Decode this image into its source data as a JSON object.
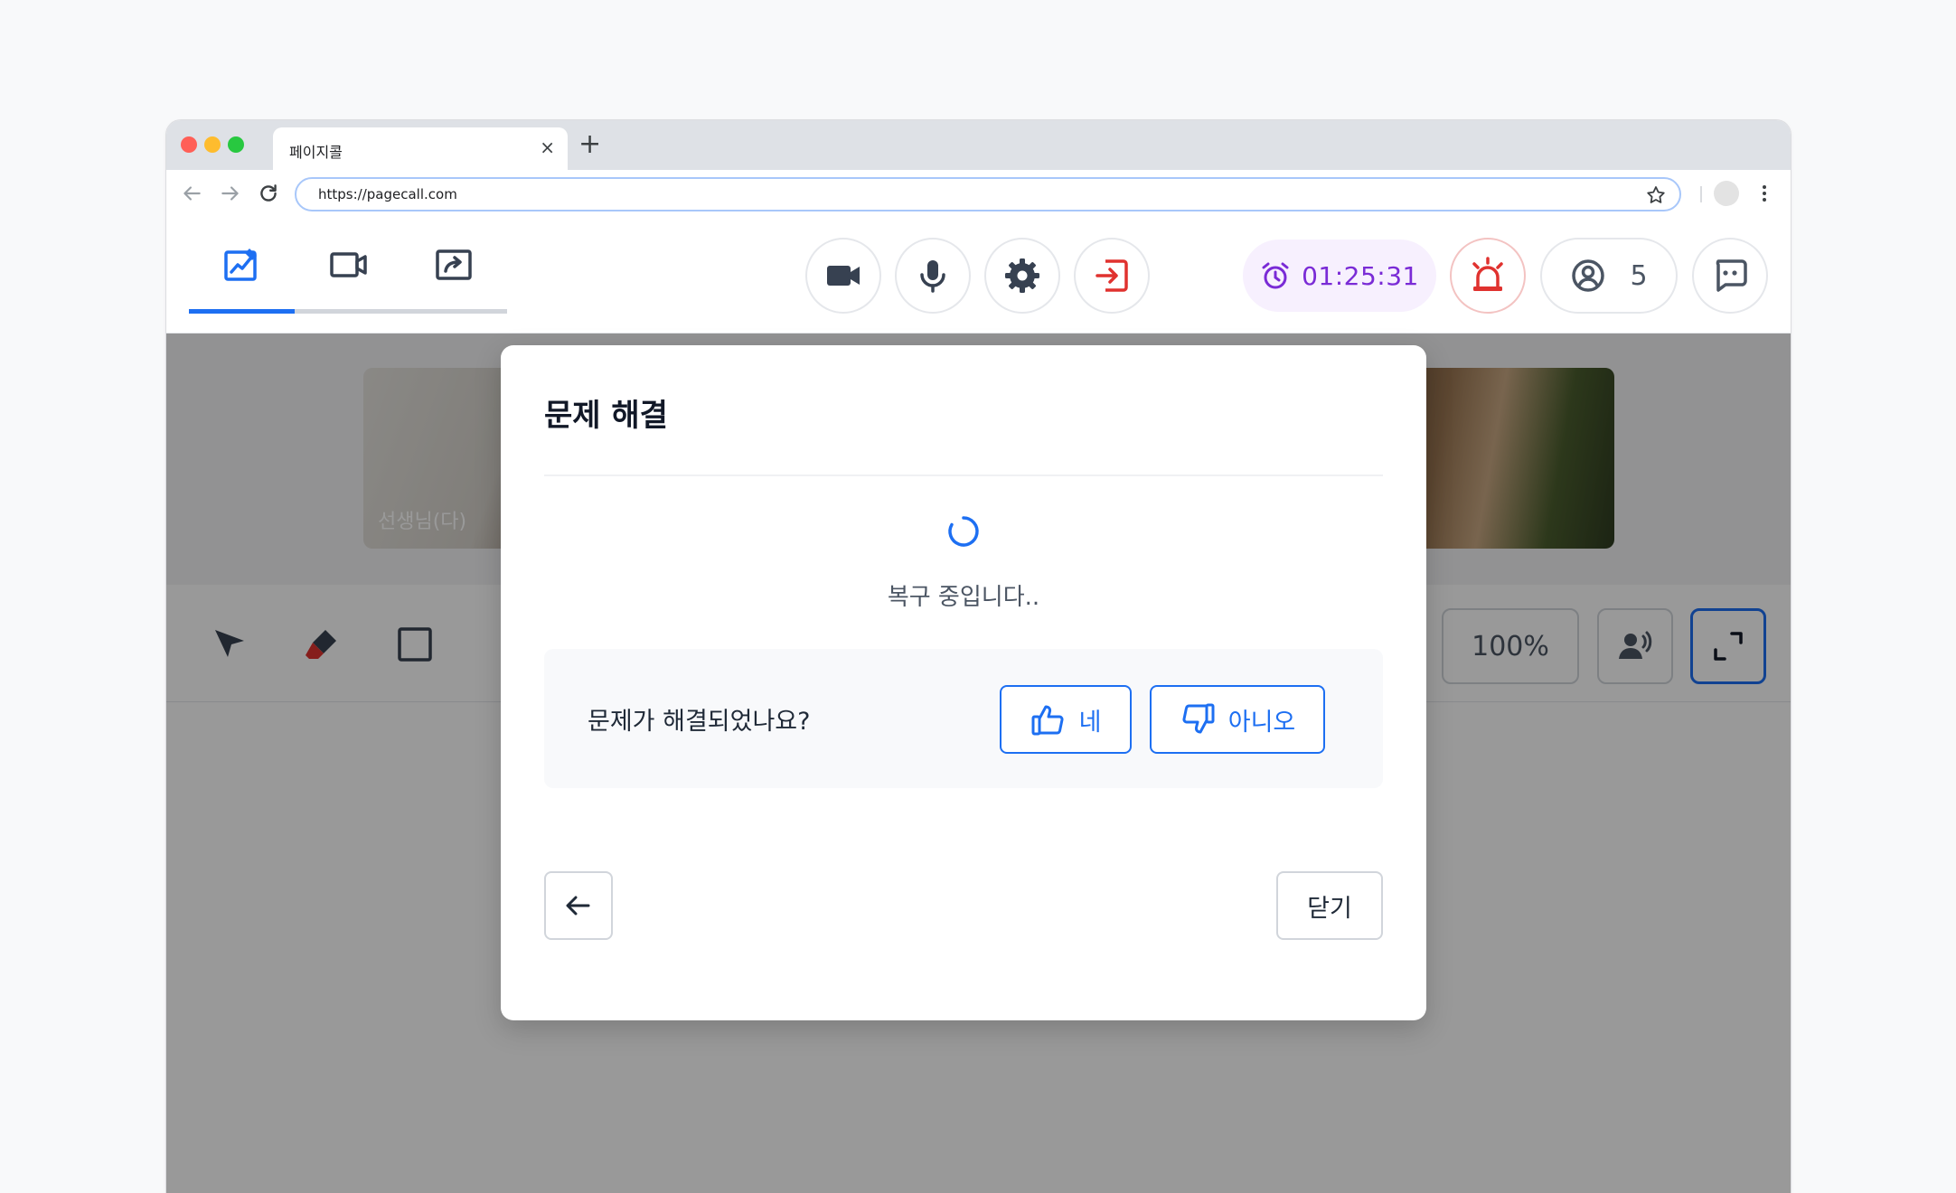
{
  "browser": {
    "tab_title": "페이지콜",
    "tab_close": "×",
    "new_tab": "+",
    "url": "https://pagecall.com"
  },
  "toolbar": {
    "mode_tabs": [
      {
        "name": "whiteboard",
        "icon": "whiteboard-edit-icon",
        "active": true
      },
      {
        "name": "video",
        "icon": "video-camera-icon",
        "active": false
      },
      {
        "name": "screen-share",
        "icon": "screen-share-icon",
        "active": false
      }
    ],
    "timer": "01:25:31",
    "participants_count": "5",
    "colors": {
      "accent": "#1d6ff2",
      "danger": "#e0322f",
      "timer": "#7a2bd6",
      "timer_bg": "#f7f0fe"
    }
  },
  "stage": {
    "videos": [
      {
        "label": "선생님(다)"
      },
      {
        "label": ""
      }
    ],
    "zoom": "100%"
  },
  "modal": {
    "title": "문제 해결",
    "status": "복구 중입니다..",
    "question": "문제가 해결되었나요?",
    "yes_label": "네",
    "no_label": "아니오",
    "close_label": "닫기"
  }
}
